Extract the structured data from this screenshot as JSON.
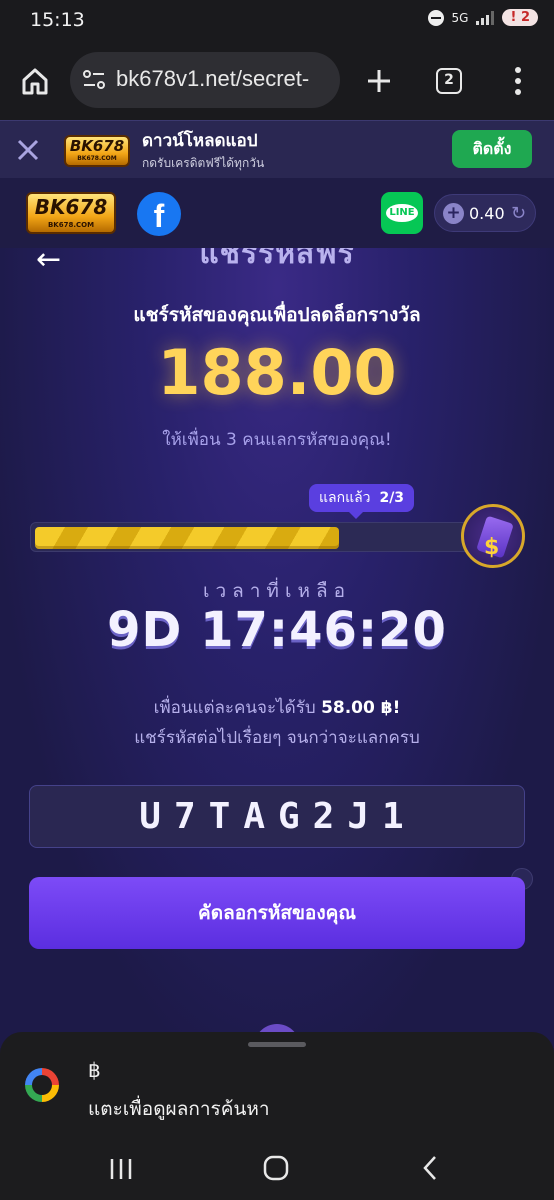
{
  "status_bar": {
    "time": "15:13",
    "network": "5G",
    "notification_count": "2"
  },
  "browser": {
    "url": "bk678v1.net/secret-",
    "tab_count": "2",
    "icons": [
      "home-icon",
      "site-settings-icon",
      "new-tab-plus-icon",
      "tabs-icon",
      "more-menu-icon"
    ]
  },
  "install_banner": {
    "logo_text": "BK678",
    "logo_subtext": "BK678.COM",
    "title": "ดาวน์โหลดแอป",
    "subtitle": "กดรับเครดิตฟรีได้ทุกวัน",
    "install_label": "ติดตั้ง"
  },
  "header": {
    "logo_text": "BK678",
    "logo_subtext": "BK678.COM",
    "facebook_glyph": "f",
    "line_label": "LINE",
    "balance": "0.40"
  },
  "main": {
    "page_title": "แชร์รหัสฟรี",
    "headline": "แชร์รหัสของคุณเพื่อปลดล็อกรางวัล",
    "reward_amount": "188.00",
    "invite_text": "ให้เพื่อน 3 คนแลกรหัสของคุณ!",
    "progress": {
      "label": "แลกแล้ว",
      "value_text": "2/3",
      "completed": 2,
      "total": 3
    },
    "time_label": "เวลาที่เหลือ",
    "time_remaining": "9D 17:46:20",
    "friend_reward_prefix": "เพื่อนแต่ละคนจะได้รับ",
    "friend_reward_amount": "58.00 ฿!",
    "keep_sharing": "แชร์รหัสต่อไปเรื่อยๆ จนกว่าจะแลกครบ",
    "share_code": "U7TAG2J1",
    "copy_button_label": "คัดลอกรหัสของคุณ"
  },
  "google_sheet": {
    "query": "฿",
    "hint": "แตะเพื่อดูผลการค้นหา"
  },
  "colors": {
    "accent_purple": "#5b2ee0",
    "gold": "#ffd45a",
    "install_green": "#1fa851",
    "page_bg": "#1d1a48"
  }
}
